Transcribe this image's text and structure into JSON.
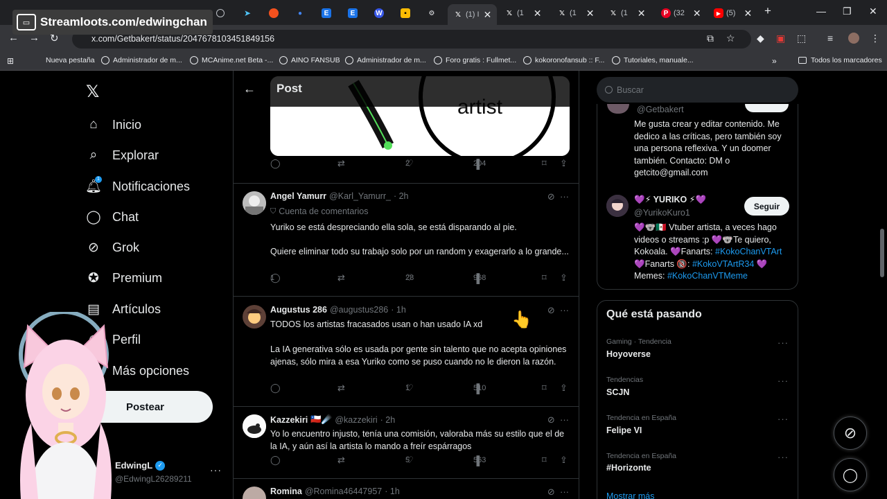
{
  "overlay": {
    "text": "Streamloots.com/edwingchan"
  },
  "browser": {
    "tabs": [
      {
        "label": "(1) I",
        "icon": "x-logo-icon"
      },
      {
        "label": "(1",
        "icon": "x-logo-icon"
      },
      {
        "label": "(1",
        "icon": "x-logo-icon"
      },
      {
        "label": "(1",
        "icon": "x-logo-icon"
      },
      {
        "label": "(32",
        "icon": "pinterest-icon"
      },
      {
        "label": "(5)",
        "icon": "youtube-icon"
      }
    ],
    "url": "x.com/Getbakert/status/2047678103451849156",
    "bookmarks": [
      "Nueva pestaña",
      "Administrador de m...",
      "MCAnime.net Beta -...",
      "AINO FANSUB",
      "Administrador de m...",
      "Foro gratis : Fullmet...",
      "kokoronofansub :: F...",
      "Tutoriales, manuale..."
    ],
    "all_bookmarks": "Todos los marcadores"
  },
  "nav": {
    "items": [
      {
        "label": "Inicio",
        "icon": "home-icon"
      },
      {
        "label": "Explorar",
        "icon": "search-icon"
      },
      {
        "label": "Notificaciones",
        "icon": "bell-icon"
      },
      {
        "label": "Chat",
        "icon": "chat-icon"
      },
      {
        "label": "Grok",
        "icon": "grok-icon"
      },
      {
        "label": "Premium",
        "icon": "premium-icon"
      },
      {
        "label": "Artículos",
        "icon": "articles-icon"
      },
      {
        "label": "Perfil",
        "icon": "profile-icon"
      },
      {
        "label": "Más opciones",
        "icon": "more-icon"
      }
    ],
    "notif_badge": "1",
    "post_button": "Postear",
    "account": {
      "name": "EdwingL",
      "handle": "@EdwingL26289211"
    }
  },
  "post": {
    "header_title": "Post",
    "media_text": "artist",
    "stats": {
      "likes": "2",
      "views": "204"
    }
  },
  "replies": [
    {
      "name": "Angel Yamurr",
      "handle": "@Karl_Yamurr_",
      "time": "· 2h",
      "sub": "Cuenta de comentarios",
      "text": [
        "Yuriko se está despreciando ella sola, se está disparando al pie.",
        "Quiere eliminar todo su trabajo solo por un random y exagerarlo a lo grande..."
      ],
      "replies": "1",
      "likes": "28",
      "views": "968"
    },
    {
      "name": "Augustus 286",
      "handle": "@augustus286",
      "time": "· 1h",
      "text": [
        "TODOS los artistas fracasados usan o han usado IA xd",
        "La IA generativa sólo es usada por gente sin talento que no acepta opiniones ajenas, sólo mira a esa Yuriko como se puso cuando no le dieron la razón."
      ],
      "replies": "",
      "likes": "1",
      "views": "510"
    },
    {
      "name": "Kazzekiri",
      "flags": "🇨🇱☄️",
      "handle": "@kazzekiri",
      "time": "· 2h",
      "text": [
        "Yo lo encuentro injusto, tenía una comisión, valoraba más su estilo que el de la IA, y aún así la artista lo mando a freír espárragos"
      ],
      "replies": "",
      "likes": "5",
      "views": "563"
    },
    {
      "name": "Romina",
      "handle": "@Romina46447957",
      "time": "· 1h"
    }
  ],
  "right": {
    "search_placeholder": "Buscar",
    "profile1": {
      "handle": "@Getbakert",
      "bio": "Me gusta crear y editar contenido. Me dedico a las críticas, pero también soy una persona reflexiva. Y un doomer también. Contacto: DM o getcito@gmail.com"
    },
    "profile2": {
      "name": "💜⚡ YURIKO ⚡💜",
      "handle": "@YurikoKuro1",
      "follow": "Seguir",
      "bio_line1": "💜🐨🇲🇽 Vtuber artista, a veces hago",
      "bio_line2": "videos o streams :p 💜🐨Te quiero,",
      "bio_line3a": "Kokoala. 💜Fanarts: ",
      "bio_line3b": "#KokoChanVTArt",
      "bio_line4a": "💜Fanarts 🔞: ",
      "bio_line4b": "#KokoVTArtR34",
      "bio_line4c": " 💜",
      "bio_line5a": "Memes: ",
      "bio_line5b": "#KokoChanVTMeme"
    },
    "trends_title": "Qué está pasando",
    "trends": [
      {
        "category": "Gaming · Tendencia",
        "name": "Hoyoverse"
      },
      {
        "category": "Tendencias",
        "name": "SCJN"
      },
      {
        "category": "Tendencia en España",
        "name": "Felipe VI"
      },
      {
        "category": "Tendencia en España",
        "name": "#Horizonte"
      }
    ],
    "show_more": "Mostrar más"
  },
  "colors": {
    "accent": "#1d9bf0",
    "background": "#000000",
    "border": "#2f3336",
    "muted": "#71767b"
  }
}
